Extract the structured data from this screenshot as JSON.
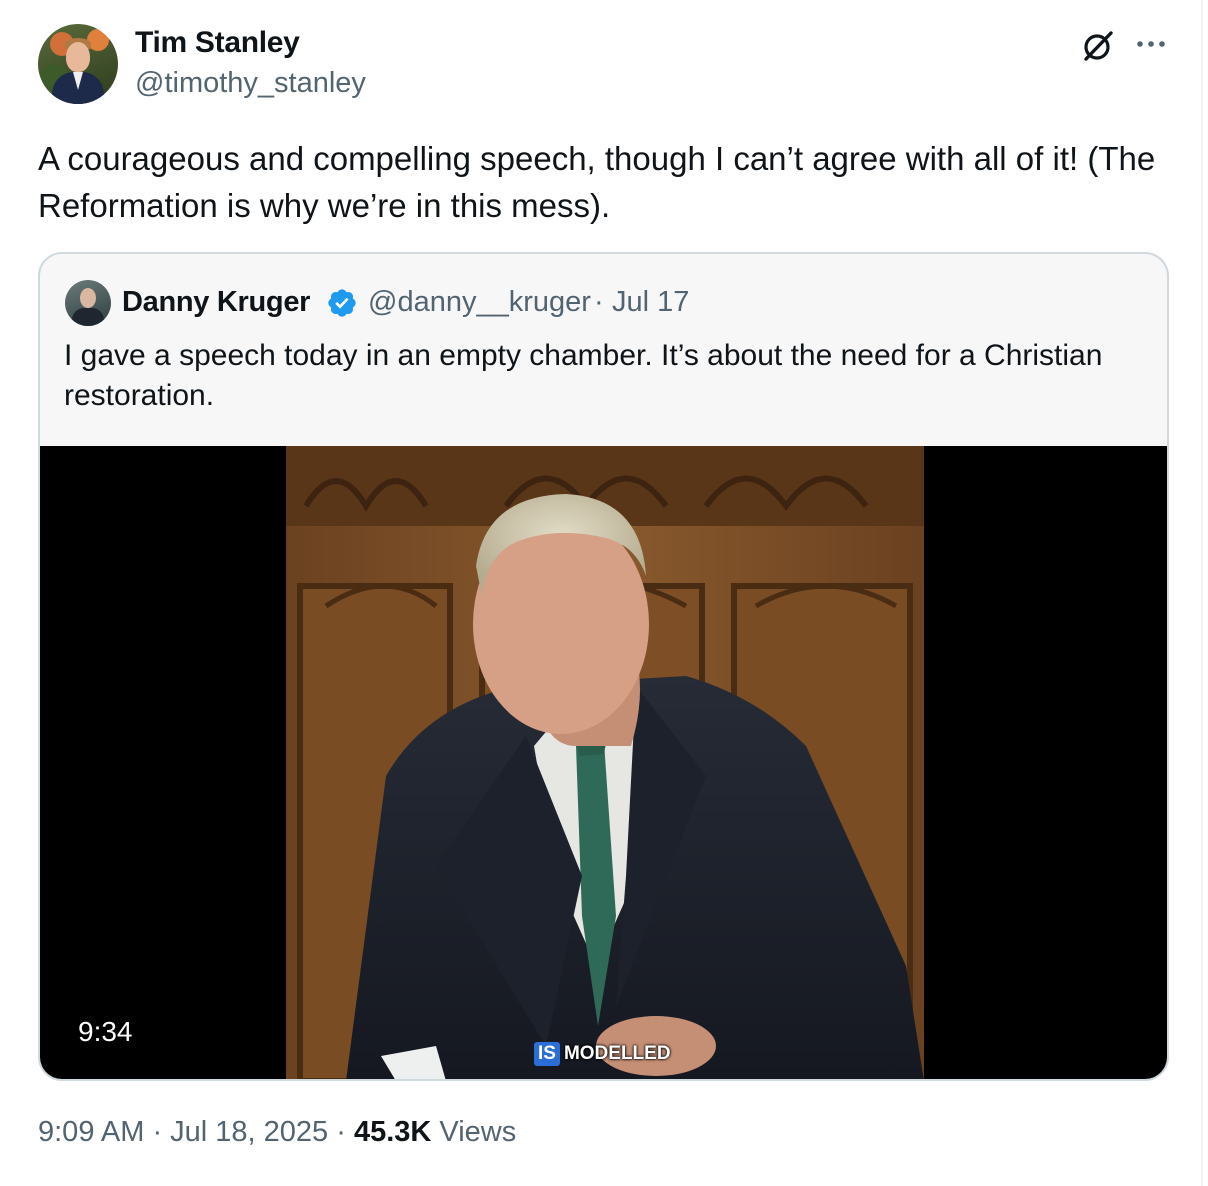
{
  "tweet": {
    "author_name": "Tim Stanley",
    "author_handle": "@timothy_stanley",
    "text": "A courageous and compelling speech, though I can’t agree with all of it! (The Reformation is why we’re in this mess).",
    "timestamp": "9:09 AM · Jul 18, 2025",
    "separator": " · ",
    "views_count": "45.3K",
    "views_label": "Views"
  },
  "quote": {
    "author_name": "Danny Kruger",
    "author_handle": "@danny__kruger",
    "separator": "·",
    "date": "Jul 17",
    "text": "I gave a speech today in an empty chamber. It’s about the need for a Christian restoration.",
    "video": {
      "duration": "9:34",
      "watermark_badge": "IS",
      "watermark_text": "MODELLED"
    }
  },
  "icons": {
    "grok": "grok-icon",
    "more": "more-options-icon",
    "verified": "verified-badge-icon"
  },
  "colors": {
    "verified_blue": "#1d9bf0",
    "secondary_text": "#536471",
    "primary_text": "#0f1419",
    "quote_border": "#cfd9de"
  }
}
